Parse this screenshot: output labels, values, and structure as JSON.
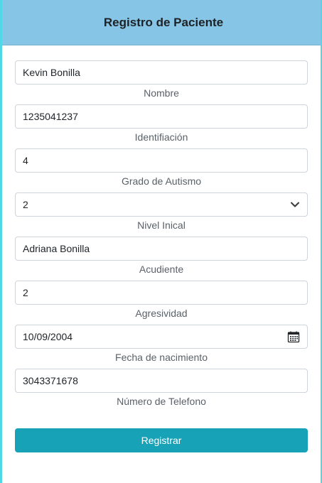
{
  "header": {
    "title": "Registro de Paciente"
  },
  "form": {
    "nombre": {
      "value": "Kevin Bonilla",
      "label": "Nombre"
    },
    "identificacion": {
      "value": "1235041237",
      "label": "Identifiación"
    },
    "grado_autismo": {
      "value": "4",
      "label": "Grado de Autismo"
    },
    "nivel_inicial": {
      "value": "2",
      "label": "Nivel Inical"
    },
    "acudiente": {
      "value": "Adriana Bonilla",
      "label": "Acudiente"
    },
    "agresividad": {
      "value": "2",
      "label": "Agresividad"
    },
    "fecha_nacimiento": {
      "value": "10/09/2004",
      "label": "Fecha de nacimiento"
    },
    "telefono": {
      "value": "3043371678",
      "label": "Número de Telefono"
    },
    "submit_label": "Registrar"
  },
  "colors": {
    "header_bg": "#86c5e5",
    "accent_button": "#17a2b8",
    "frame_border": "#4fd8e8"
  },
  "icons": {
    "select_arrow": "chevron-down-icon",
    "date_picker": "calendar-icon"
  }
}
